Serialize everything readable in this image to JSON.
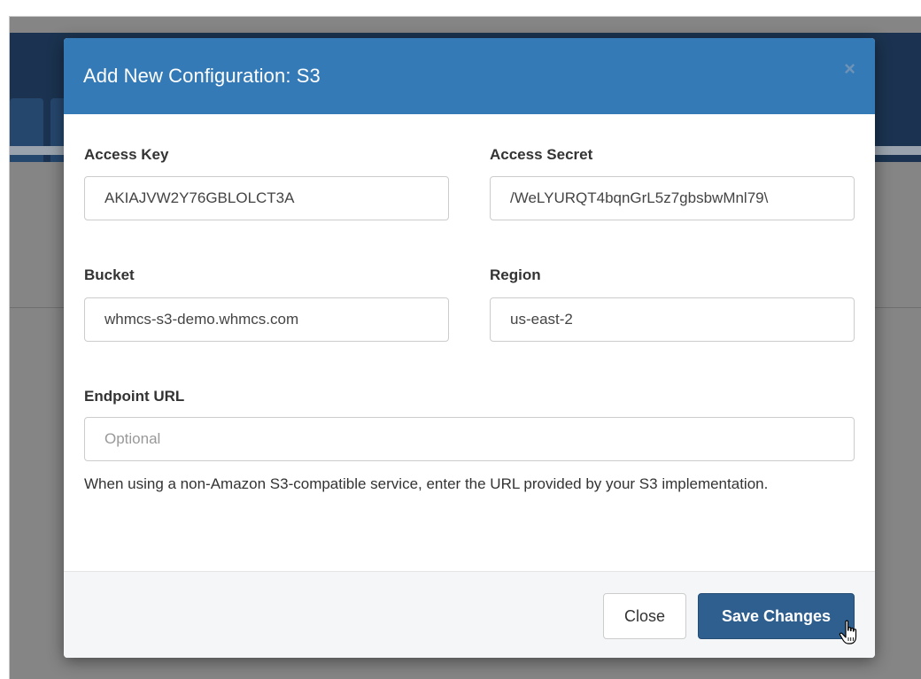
{
  "modal": {
    "title": "Add New Configuration: S3",
    "close_symbol": "×"
  },
  "form": {
    "access_key": {
      "label": "Access Key",
      "value": "AKIAJVW2Y76GBLOLCT3A"
    },
    "access_secret": {
      "label": "Access Secret",
      "value": "/WeLYURQT4bqnGrL5z7gbsbwMnl79\\"
    },
    "bucket": {
      "label": "Bucket",
      "value": "whmcs-s3-demo.whmcs.com"
    },
    "region": {
      "label": "Region",
      "value": "us-east-2"
    },
    "endpoint_url": {
      "label": "Endpoint URL",
      "value": "",
      "placeholder": "Optional",
      "help": "When using a non-Amazon S3-compatible service, enter the URL provided by your S3 implementation."
    }
  },
  "footer": {
    "close_label": "Close",
    "save_label": "Save Changes"
  },
  "colors": {
    "header_blue": "#337ab7",
    "save_button": "#2f5f8f",
    "backdrop": "#858585"
  },
  "icons": {
    "close": "close-icon",
    "cursor": "hand-pointer-icon"
  }
}
